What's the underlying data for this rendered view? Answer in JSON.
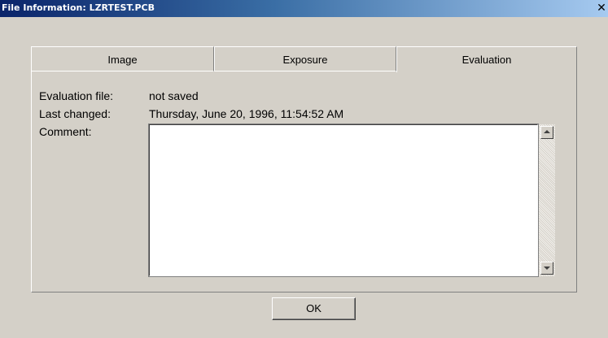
{
  "window": {
    "title": "File Information: LZRTEST.PCB",
    "close_glyph": "✕"
  },
  "tabs": [
    {
      "label": "Image",
      "active": false
    },
    {
      "label": "Exposure",
      "active": false
    },
    {
      "label": "Evaluation",
      "active": true
    }
  ],
  "evaluation": {
    "file_label": "Evaluation file:",
    "file_value": "not saved",
    "changed_label": "Last changed:",
    "changed_value": "Thursday, June 20, 1996, 11:54:52  AM",
    "comment_label": "Comment:",
    "comment_value": ""
  },
  "scrollbar": {
    "up_icon": "arrow-up-icon",
    "down_icon": "arrow-down-icon"
  },
  "buttons": {
    "ok_label": "OK"
  }
}
